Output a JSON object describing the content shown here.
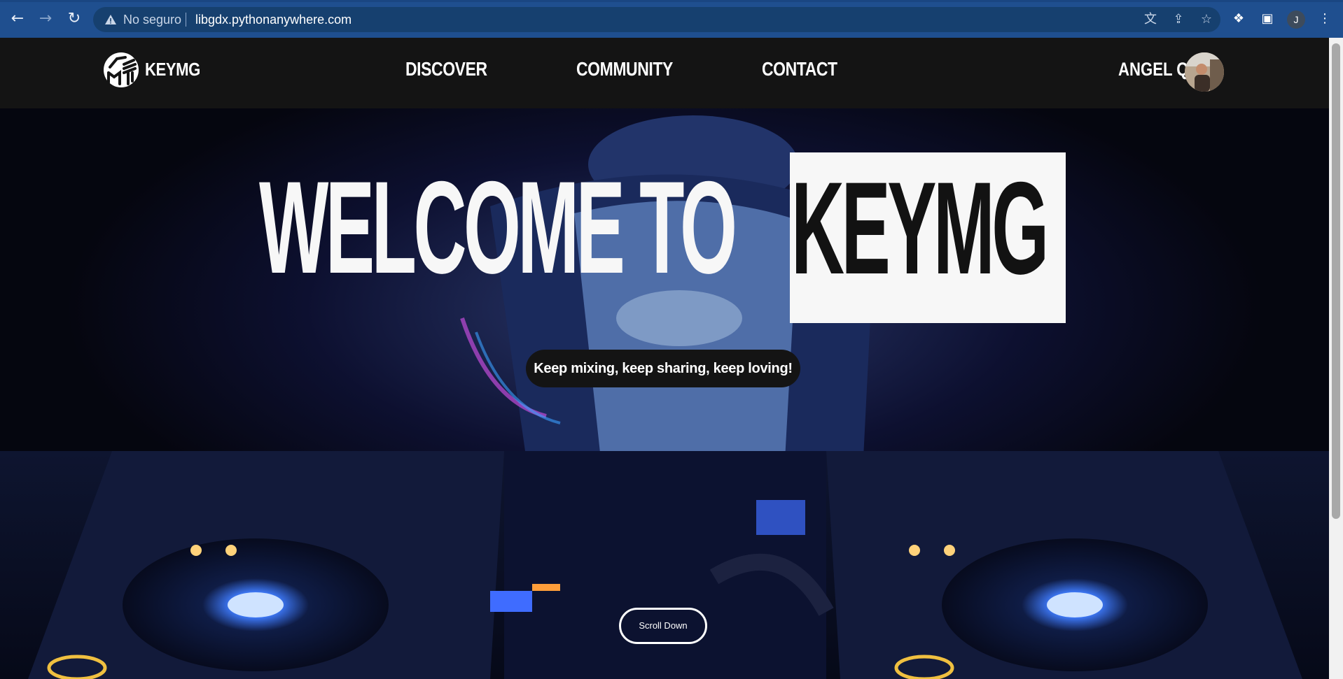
{
  "browser": {
    "back_icon": "arrow-left-icon",
    "forward_icon": "arrow-right-icon",
    "reload_icon": "reload-icon",
    "security_label": "No seguro",
    "url": "libgdx.pythonanywhere.com",
    "profile_initial": "J",
    "icons": [
      "translate-icon",
      "share-icon",
      "star-icon",
      "extensions-icon",
      "side-panel-icon",
      "menu-icon"
    ]
  },
  "header": {
    "logo_text": "KEYMG",
    "nav": [
      {
        "label": "DISCOVER"
      },
      {
        "label": "COMMUNITY"
      },
      {
        "label": "CONTACT"
      }
    ],
    "user_name": "ANGEL Q."
  },
  "hero": {
    "title_part1": "WELCOME TO",
    "title_part2": "KEYMG",
    "tagline": "Keep mixing, keep sharing, keep loving!",
    "scroll_label": "Scroll Down"
  },
  "colors": {
    "browser_bar": "#1f4f8f",
    "header_bg": "#141414",
    "hero_dark": "#070815",
    "accent_blue": "#3a6ee8"
  }
}
